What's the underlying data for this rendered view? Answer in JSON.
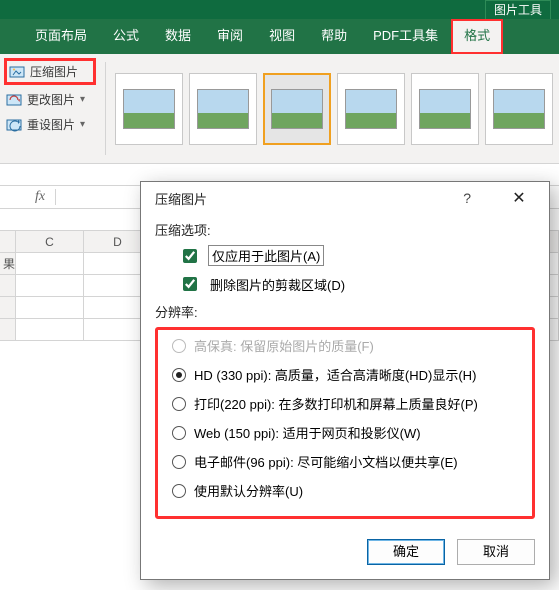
{
  "titlebar": {
    "tool_tab": "图片工具"
  },
  "ribbon": {
    "tabs": [
      "页面布局",
      "公式",
      "数据",
      "审阅",
      "视图",
      "帮助",
      "PDF工具集",
      "格式"
    ],
    "active_index": 7,
    "adjust": {
      "compress": "压缩图片",
      "change": "更改图片",
      "reset": "重设图片"
    }
  },
  "formula_bar": {
    "fx": "fx"
  },
  "columns": [
    "C",
    "D"
  ],
  "row_fragment_label": "果",
  "dialog": {
    "title": "压缩图片",
    "section_compress": "压缩选项:",
    "chk_only_this": "仅应用于此图片(A)",
    "chk_only_this_checked": true,
    "chk_delete_crop": "删除图片的剪裁区域(D)",
    "chk_delete_crop_checked": true,
    "section_resolution": "分辨率:",
    "options": [
      {
        "label": "高保真: 保留原始图片的质量(F)",
        "checked": false,
        "disabled": true
      },
      {
        "label": "HD (330 ppi): 高质量，适合高清晰度(HD)显示(H)",
        "checked": true,
        "disabled": false
      },
      {
        "label": "打印(220 ppi): 在多数打印机和屏幕上质量良好(P)",
        "checked": false,
        "disabled": false
      },
      {
        "label": "Web (150 ppi): 适用于网页和投影仪(W)",
        "checked": false,
        "disabled": false
      },
      {
        "label": "电子邮件(96 ppi): 尽可能缩小文档以便共享(E)",
        "checked": false,
        "disabled": false
      },
      {
        "label": "使用默认分辨率(U)",
        "checked": false,
        "disabled": false
      }
    ],
    "ok": "确定",
    "cancel": "取消",
    "help": "?"
  }
}
